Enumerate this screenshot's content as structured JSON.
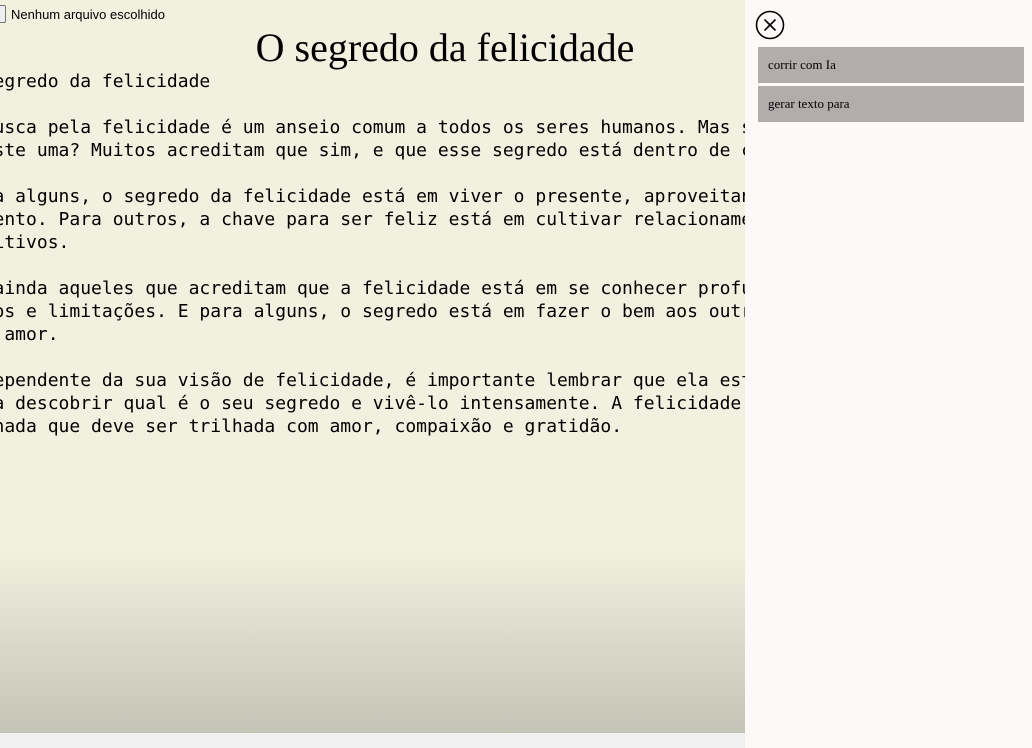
{
  "file_input": {
    "status_text": "Nenhum arquivo escolhido"
  },
  "document": {
    "title": "O segredo da felicidade",
    "paragraphs": [
      [
        "O segredo da felicidade"
      ],
      [
        "A busca pela felicidade é um anseio comum a todos os seres humanos. Mas será que",
        "existe uma? Muitos acreditam que sim, e que esse segredo está dentro de cada um"
      ],
      [
        "Para alguns, o segredo da felicidade está em viver o presente, aproveitando cada",
        "momento. Para outros, a chave para ser feliz está em cultivar relacionamentos",
        "positivos."
      ],
      [
        "Há ainda aqueles que acreditam que a felicidade está em se conhecer profundamente",
        "medos e limitações. E para alguns, o segredo está em fazer o bem aos outros",
        "com amor."
      ],
      [
        "Independente da sua visão de felicidade, é importante lembrar que ela está ao",
        "para descobrir qual é o seu segredo e vivê-lo intensamente. A felicidade não",
        "jornada que deve ser trilhada com amor, compaixão e gratidão."
      ]
    ]
  },
  "sidebar": {
    "close_icon": "close-circle-icon",
    "items": [
      {
        "label": "corrir com Ia"
      },
      {
        "label": "gerar texto para"
      }
    ]
  },
  "colors": {
    "page_background": "#f2f0de",
    "sidebar_background": "#fdf9f8",
    "menu_item_background": "#b4acac"
  }
}
